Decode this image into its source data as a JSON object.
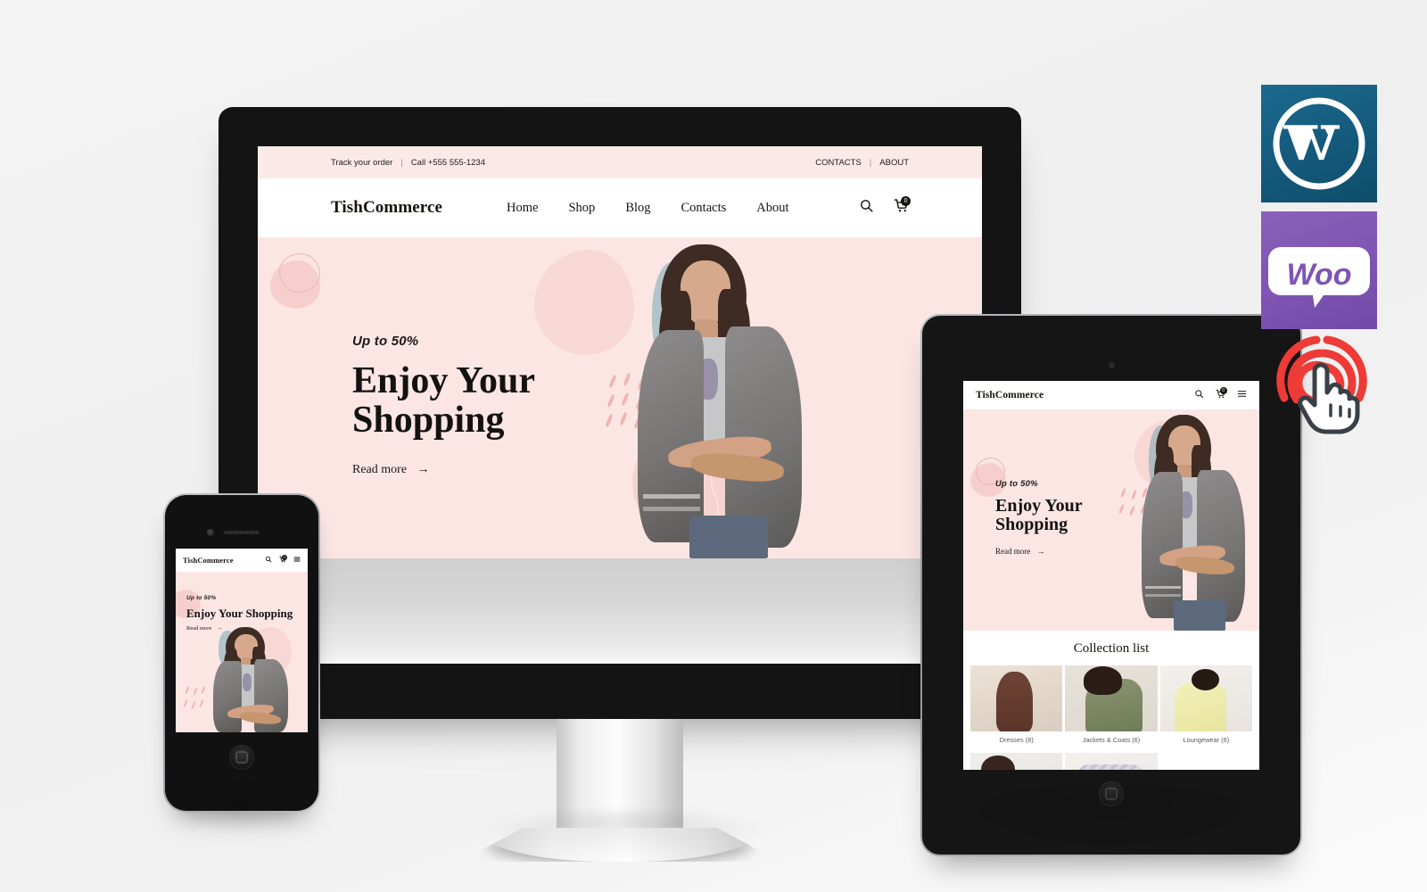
{
  "page": {
    "title": "TishCommerce responsive WooCommerce theme showcase",
    "background_color": "#f1f1f1"
  },
  "site": {
    "brand": "TishCommerce",
    "topbar": {
      "track_order": "Track your order",
      "divider": "|",
      "phone": "Call +555 555-1234",
      "contacts": "CONTACTS",
      "right_divider": "|",
      "about": "ABOUT"
    },
    "nav": {
      "items": [
        {
          "label": "Home"
        },
        {
          "label": "Shop"
        },
        {
          "label": "Blog"
        },
        {
          "label": "Contacts"
        },
        {
          "label": "About"
        }
      ],
      "search_icon": "search-icon",
      "cart_icon": "cart-icon",
      "cart_count": "0",
      "menu_icon": "hamburger-menu-icon"
    },
    "hero": {
      "eyebrow": "Up to 50%",
      "headline_line1": "Enjoy Your",
      "headline_line2": "Shopping",
      "headline_single": "Enjoy Your Shopping",
      "cta": "Read more",
      "cta_arrow": "→",
      "background_color": "#fbe6e4"
    },
    "collection": {
      "title": "Collection list",
      "items": [
        {
          "label": "Dresses (8)"
        },
        {
          "label": "Jackets & Coats (6)"
        },
        {
          "label": "Loungewear (6)"
        },
        {
          "label": ""
        },
        {
          "label": ""
        },
        {
          "label": ""
        }
      ]
    }
  },
  "devices": {
    "desktop": {
      "name": "iMac desktop monitor"
    },
    "tablet": {
      "name": "iPad tablet"
    },
    "phone": {
      "name": "iPhone smartphone"
    }
  },
  "badges": {
    "wordpress": {
      "name": "wordpress-logo",
      "letter": "W",
      "color": "#14597b"
    },
    "woocommerce": {
      "name": "woocommerce-logo",
      "text": "Woo",
      "color": "#7f54b3"
    },
    "responsive_click": {
      "name": "responsive-click-icon",
      "color": "#ee3b38"
    }
  }
}
